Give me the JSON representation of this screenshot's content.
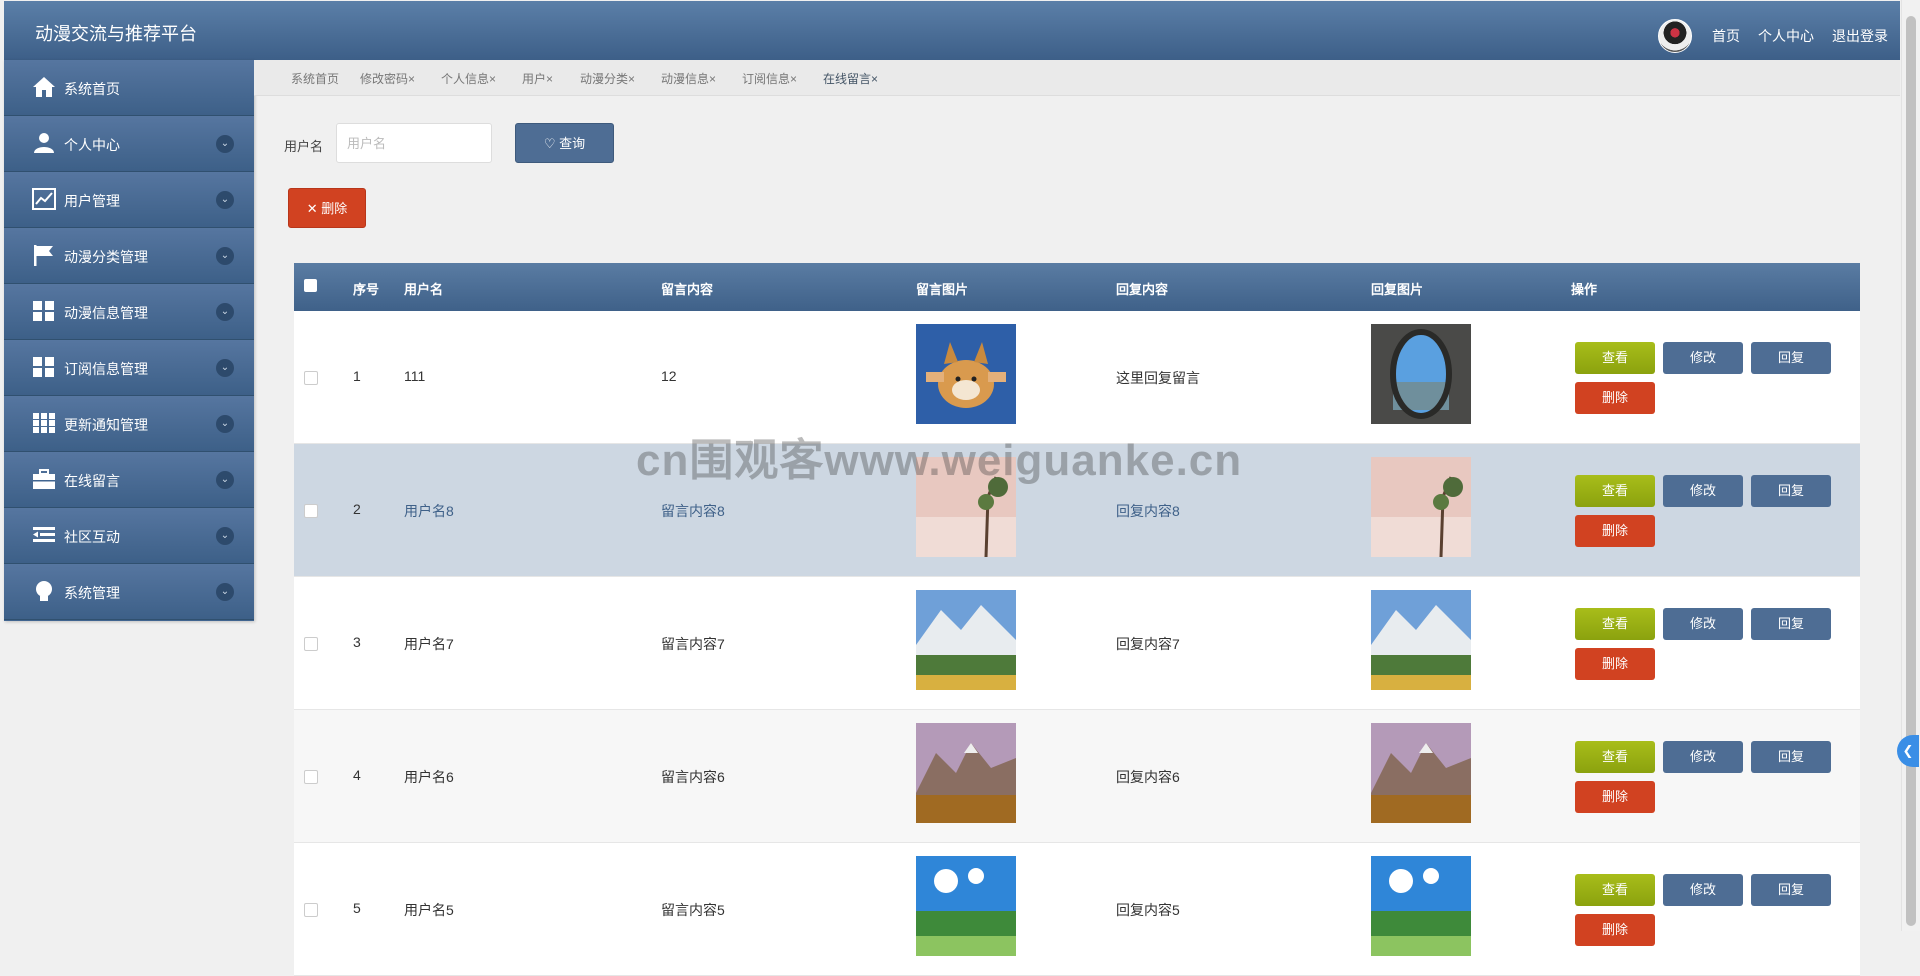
{
  "header": {
    "app_title": "动漫交流与推荐平台",
    "nav": {
      "home": "首页",
      "profile": "个人中心",
      "logout": "退出登录"
    }
  },
  "sidebar": {
    "items": [
      {
        "label": "系统首页",
        "icon": "home-icon"
      },
      {
        "label": "个人中心",
        "icon": "user-icon"
      },
      {
        "label": "用户管理",
        "icon": "chart-icon"
      },
      {
        "label": "动漫分类管理",
        "icon": "flag-icon"
      },
      {
        "label": "动漫信息管理",
        "icon": "grid-icon"
      },
      {
        "label": "订阅信息管理",
        "icon": "grid-icon"
      },
      {
        "label": "更新通知管理",
        "icon": "apps-icon"
      },
      {
        "label": "在线留言",
        "icon": "briefcase-icon"
      },
      {
        "label": "社区互动",
        "icon": "list-icon"
      },
      {
        "label": "系统管理",
        "icon": "bulb-icon"
      }
    ]
  },
  "tabs": [
    {
      "label": "系统首页"
    },
    {
      "label": "修改密码×"
    },
    {
      "label": "个人信息×"
    },
    {
      "label": "用户×"
    },
    {
      "label": "动漫分类×"
    },
    {
      "label": "动漫信息×"
    },
    {
      "label": "订阅信息×"
    },
    {
      "label": "在线留言×"
    }
  ],
  "search": {
    "label": "用户名",
    "placeholder": "用户名",
    "value": "",
    "query_button": "查询"
  },
  "delete_button": "删除",
  "table": {
    "columns": [
      "序号",
      "用户名",
      "留言内容",
      "留言图片",
      "回复内容",
      "回复图片",
      "操作"
    ],
    "actions": {
      "view": "查看",
      "edit": "修改",
      "reply": "回复",
      "delete": "删除"
    },
    "rows": [
      {
        "index": "1",
        "username": "111",
        "content": "12",
        "reply": "这里回复留言"
      },
      {
        "index": "2",
        "username": "用户名8",
        "content": "留言内容8",
        "reply": "回复内容8"
      },
      {
        "index": "3",
        "username": "用户名7",
        "content": "留言内容7",
        "reply": "回复内容7"
      },
      {
        "index": "4",
        "username": "用户名6",
        "content": "留言内容6",
        "reply": "回复内容6"
      },
      {
        "index": "5",
        "username": "用户名5",
        "content": "留言内容5",
        "reply": "回复内容5"
      }
    ]
  },
  "watermark": "cn围观客www.weiguanke.cn",
  "colors": {
    "header": "#4a6d96",
    "accent": "#4e6d94",
    "danger": "#d14221",
    "view": "#9ab214"
  }
}
